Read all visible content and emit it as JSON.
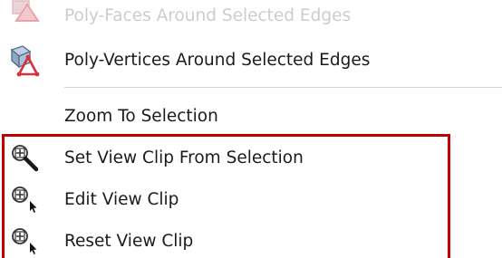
{
  "menu": {
    "items": [
      {
        "label": "Poly-Faces Around Selected Edges",
        "icon": "poly-faces-icon",
        "state": "faded"
      },
      {
        "label": "Poly-Vertices Around Selected Edges",
        "icon": "poly-vertices-icon"
      },
      {
        "label": "Zoom To Selection",
        "icon": null
      },
      {
        "label": "Set View Clip From Selection",
        "icon": "view-clip-magnify-icon"
      },
      {
        "label": "Edit View Clip",
        "icon": "view-clip-cursor-icon"
      },
      {
        "label": "Reset View Clip",
        "icon": "view-clip-cursor-icon"
      }
    ]
  },
  "colors": {
    "highlight_border": "#c00000",
    "text": "#1b1b1b",
    "faded_text": "#c9cdd2",
    "icon_red": "#d9303a",
    "icon_blue": "#6f8fb3"
  }
}
